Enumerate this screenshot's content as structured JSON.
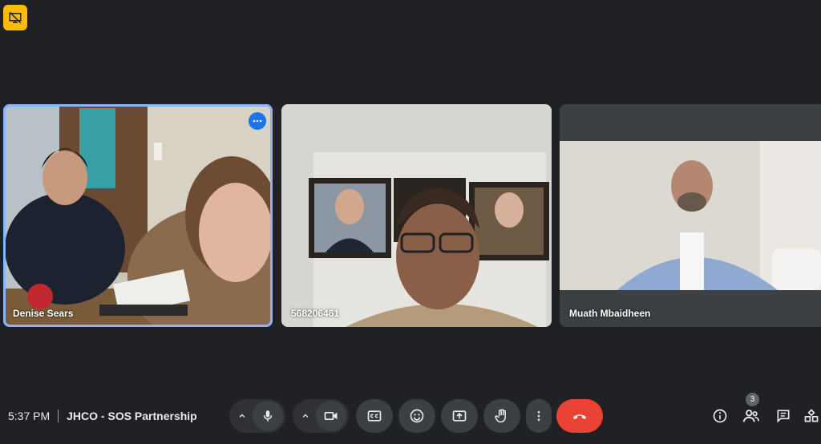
{
  "participants": [
    {
      "name": "Denise Sears"
    },
    {
      "name": "568206461"
    },
    {
      "name": "Muath Mbaidheen"
    }
  ],
  "meeting": {
    "time": "5:37 PM",
    "title": "JHCO - SOS Partnership"
  },
  "people_count": "3",
  "colors": {
    "background": "#202124",
    "active_speaker": "#8ab4f8",
    "end_call": "#ea4335",
    "badge": "#fbbc04"
  },
  "icons": {
    "top_badge": "presentation-off-icon",
    "controls": [
      "caret-up-icon",
      "mic-icon",
      "caret-up-icon",
      "camera-icon",
      "captions-icon",
      "emoji-icon",
      "present-icon",
      "raise-hand-icon",
      "more-vert-icon",
      "end-call-icon"
    ],
    "right": [
      "info-icon",
      "people-icon",
      "chat-icon",
      "activities-icon"
    ]
  }
}
